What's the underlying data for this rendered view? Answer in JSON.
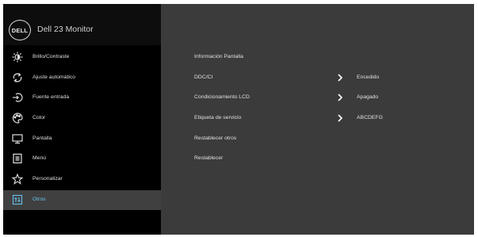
{
  "header": {
    "logo_text": "DELL",
    "title": "Dell 23 Monitor"
  },
  "sidebar": {
    "items": [
      {
        "label": "Brillo/Contraste",
        "icon": "brightness-icon"
      },
      {
        "label": "Ajuste automático",
        "icon": "auto-adjust-icon"
      },
      {
        "label": "Fuente entrada",
        "icon": "input-source-icon"
      },
      {
        "label": "Color",
        "icon": "color-palette-icon"
      },
      {
        "label": "Pantalla",
        "icon": "display-icon"
      },
      {
        "label": "Menú",
        "icon": "menu-icon"
      },
      {
        "label": "Personalizar",
        "icon": "star-icon"
      },
      {
        "label": "Otros",
        "icon": "others-icon",
        "active": true
      }
    ]
  },
  "panel": {
    "rows": [
      {
        "label": "Información Pantalla",
        "value": ""
      },
      {
        "label": "DDC/CI",
        "value": "Encedido",
        "chevron": true
      },
      {
        "label": "Condicionamiento LCD",
        "value": "Apagado",
        "chevron": true
      },
      {
        "label": "Etiqueta de servicio",
        "value": "ABCDEFG",
        "chevron": true
      },
      {
        "label": "Restablecer otros",
        "value": ""
      },
      {
        "label": "Restablecer",
        "value": ""
      }
    ]
  },
  "colors": {
    "header_bg": "#0d0d0d",
    "sidebar_bg": "#000000",
    "panel_bg": "#3b3b3b",
    "active_item_bg": "#404040",
    "active_item_text": "#66c2ee",
    "text": "#dedede"
  }
}
